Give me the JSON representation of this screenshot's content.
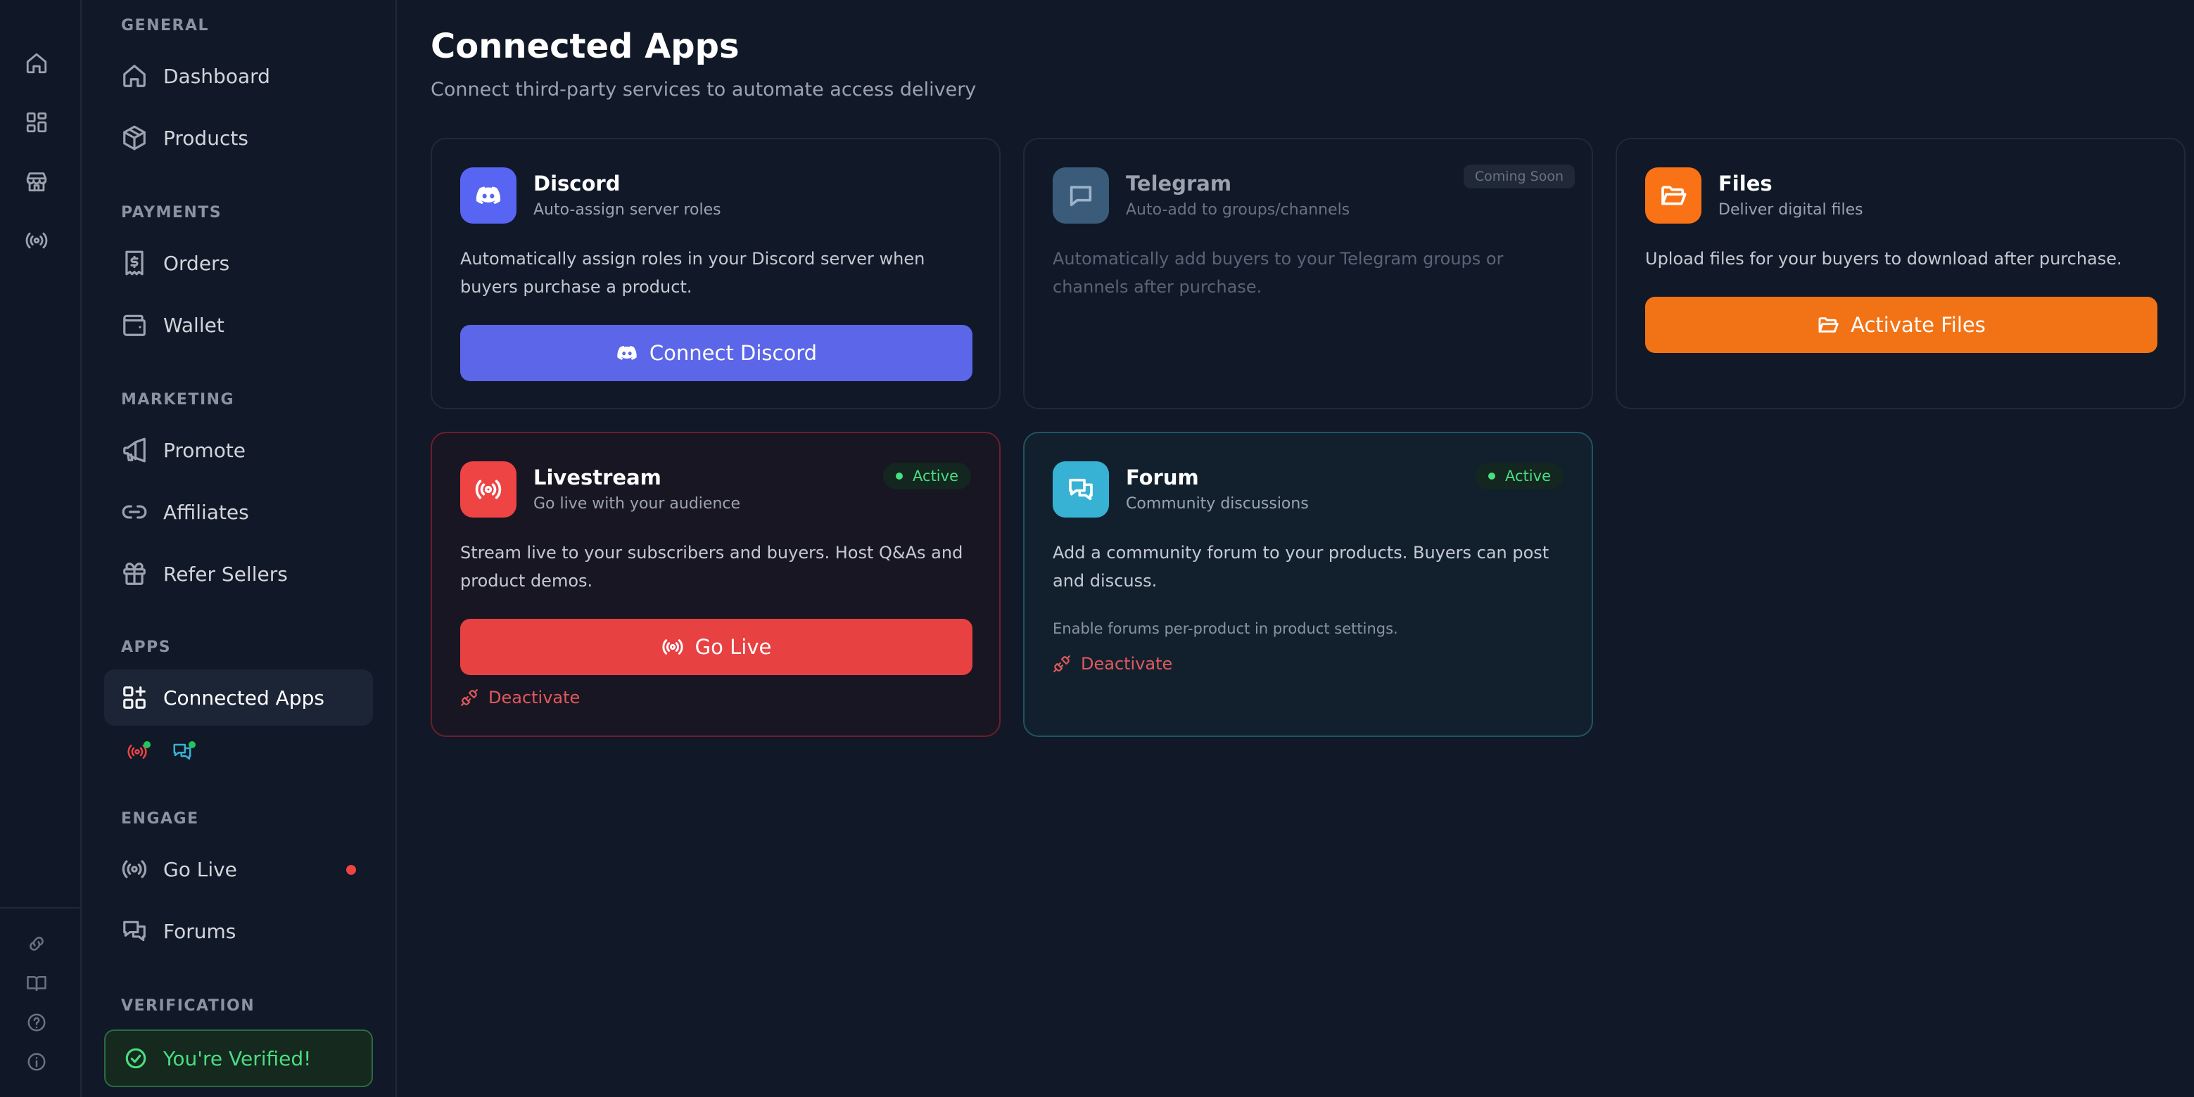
{
  "sidebar": {
    "sections": {
      "general": "GENERAL",
      "payments": "PAYMENTS",
      "marketing": "MARKETING",
      "apps": "APPS",
      "engage": "ENGAGE",
      "verification": "VERIFICATION"
    },
    "items": {
      "dashboard": "Dashboard",
      "products": "Products",
      "orders": "Orders",
      "wallet": "Wallet",
      "promote": "Promote",
      "affiliates": "Affiliates",
      "refer_sellers": "Refer Sellers",
      "connected_apps": "Connected Apps",
      "go_live": "Go Live",
      "forums": "Forums"
    },
    "verified_label": "You're Verified!"
  },
  "main": {
    "title": "Connected Apps",
    "subtitle": "Connect third-party services to automate access delivery",
    "cards": {
      "discord": {
        "name": "Discord",
        "tagline": "Auto-assign server roles",
        "description": "Automatically assign roles in your Discord server when buyers purchase a product.",
        "button": "Connect Discord",
        "color": "#5865f2"
      },
      "telegram": {
        "name": "Telegram",
        "tagline": "Auto-add to groups/channels",
        "badge": "Coming Soon",
        "description": "Automatically add buyers to your Telegram groups or channels after purchase.",
        "color": "#3b5b7a"
      },
      "files": {
        "name": "Files",
        "tagline": "Deliver digital files",
        "description": "Upload files for your buyers to download after purchase.",
        "button": "Activate Files",
        "color": "#f97316"
      },
      "livestream": {
        "name": "Livestream",
        "tagline": "Go live with your audience",
        "badge": "Active",
        "description": "Stream live to your subscribers and buyers. Host Q&As and product demos.",
        "button": "Go Live",
        "deactivate": "Deactivate",
        "color": "#ef4444"
      },
      "forum": {
        "name": "Forum",
        "tagline": "Community discussions",
        "badge": "Active",
        "description": "Add a community forum to your products. Buyers can post and discuss.",
        "hint": "Enable forums per-product in product settings.",
        "deactivate": "Deactivate",
        "color": "#38b2d4"
      }
    }
  }
}
